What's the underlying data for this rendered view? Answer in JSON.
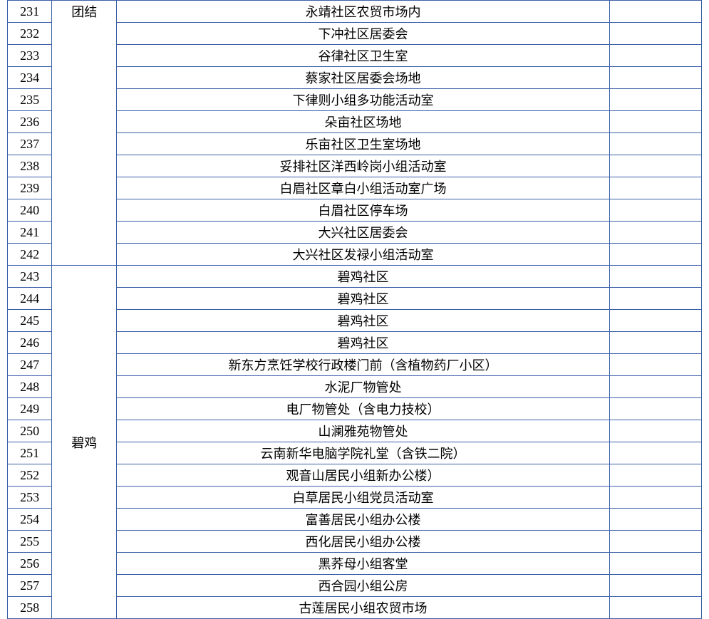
{
  "rows": [
    {
      "num": "231",
      "region": "团结",
      "desc": "永靖社区农贸市场内",
      "region_rowspan": 12
    },
    {
      "num": "232",
      "desc": "下冲社区居委会"
    },
    {
      "num": "233",
      "desc": "谷律社区卫生室"
    },
    {
      "num": "234",
      "desc": "蔡家社区居委会场地"
    },
    {
      "num": "235",
      "desc": "下律则小组多功能活动室"
    },
    {
      "num": "236",
      "desc": "朵亩社区场地",
      "dashed_top": true
    },
    {
      "num": "237",
      "desc": "乐亩社区卫生室场地"
    },
    {
      "num": "238",
      "desc": "妥排社区洋西岭岗小组活动室"
    },
    {
      "num": "239",
      "desc": "白眉社区章白小组活动室广场"
    },
    {
      "num": "240",
      "desc": "白眉社区停车场"
    },
    {
      "num": "241",
      "desc": "大兴社区居委会"
    },
    {
      "num": "242",
      "desc": "大兴社区发禄小组活动室"
    },
    {
      "num": "243",
      "region": "碧鸡",
      "desc": "碧鸡社区",
      "region_rowspan": 16,
      "region_mid": true
    },
    {
      "num": "244",
      "desc": "碧鸡社区"
    },
    {
      "num": "245",
      "desc": "碧鸡社区"
    },
    {
      "num": "246",
      "desc": "碧鸡社区"
    },
    {
      "num": "247",
      "desc": "新东方烹饪学校行政楼门前（含植物药厂小区）"
    },
    {
      "num": "248",
      "desc": "水泥厂物管处"
    },
    {
      "num": "249",
      "desc": "电厂物管处（含电力技校）"
    },
    {
      "num": "250",
      "desc": "山澜雅苑物管处"
    },
    {
      "num": "251",
      "desc": "云南新华电脑学院礼堂（含铁二院）"
    },
    {
      "num": "252",
      "desc": "观音山居民小组新办公楼）"
    },
    {
      "num": "253",
      "desc": "白草居民小组党员活动室"
    },
    {
      "num": "254",
      "desc": "富善居民小组办公楼"
    },
    {
      "num": "255",
      "desc": "西化居民小组办公楼"
    },
    {
      "num": "256",
      "desc": "黑荞母小组客堂"
    },
    {
      "num": "257",
      "desc": "西合园小组公房"
    },
    {
      "num": "258",
      "desc": "古莲居民小组农贸市场"
    }
  ]
}
